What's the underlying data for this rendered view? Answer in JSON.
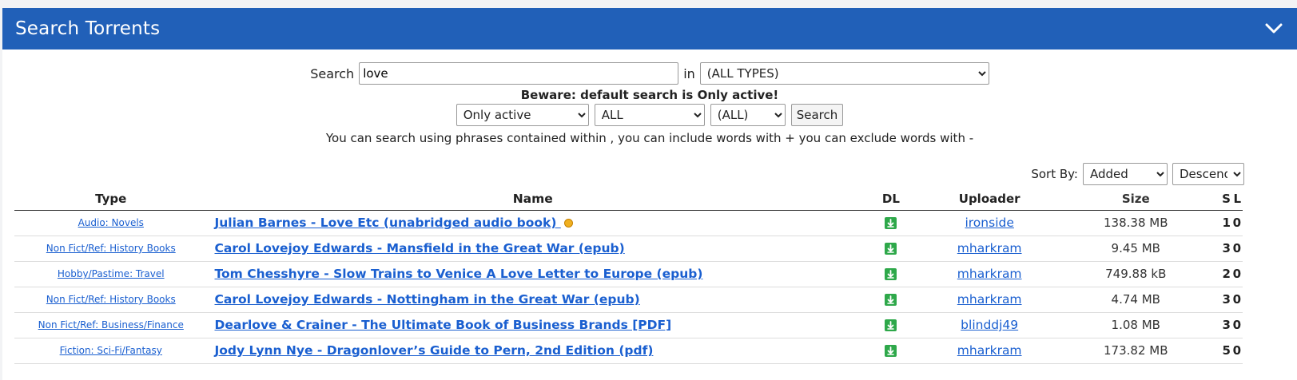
{
  "header": {
    "title": "Search Torrents"
  },
  "search": {
    "label": "Search",
    "value": "love",
    "in_label": "in",
    "type_selected": "(ALL TYPES)",
    "warning": "Beware: default search is Only active!",
    "filter_active": "Only active",
    "filter_all": "ALL",
    "filter_all2": "(ALL)",
    "button": "Search",
    "hint": "You can search using phrases contained within , you can include words with + you can exclude words with -"
  },
  "sort": {
    "label": "Sort By:",
    "field": "Added",
    "direction": "Descend"
  },
  "table": {
    "headers": {
      "type": "Type",
      "name": "Name",
      "dl": "DL",
      "uploader": "Uploader",
      "size": "Size",
      "s": "S",
      "l": "L"
    },
    "rows": [
      {
        "type": "Audio: Novels",
        "name": "Julian Barnes - Love Etc (unabridged audio book) ",
        "uploader": "ironside",
        "size": "138.38 MB",
        "s": "1",
        "l": "0"
      },
      {
        "type": "Non Fict/Ref: History Books",
        "name": "Carol Lovejoy Edwards - Mansfield in the Great War (epub)",
        "uploader": "mharkram",
        "size": "9.45 MB",
        "s": "3",
        "l": "0"
      },
      {
        "type": "Hobby/Pastime: Travel",
        "name": "Tom Chesshyre - Slow Trains to Venice A Love Letter to Europe (epub)",
        "uploader": "mharkram",
        "size": "749.88 kB",
        "s": "2",
        "l": "0"
      },
      {
        "type": "Non Fict/Ref: History Books",
        "name": "Carol Lovejoy Edwards - Nottingham in the Great War (epub)",
        "uploader": "mharkram",
        "size": "4.74 MB",
        "s": "3",
        "l": "0"
      },
      {
        "type": "Non Fict/Ref: Business/Finance",
        "name": "Dearlove & Crainer - The Ultimate Book of Business Brands [PDF]",
        "uploader": "blinddj49",
        "size": "1.08 MB",
        "s": "3",
        "l": "0"
      },
      {
        "type": "Fiction: Sci-Fi/Fantasy",
        "name": "Jody Lynn Nye - Dragonlover’s Guide to Pern, 2nd Edition (pdf)",
        "uploader": "mharkram",
        "size": "173.82 MB",
        "s": "5",
        "l": "0"
      }
    ]
  }
}
